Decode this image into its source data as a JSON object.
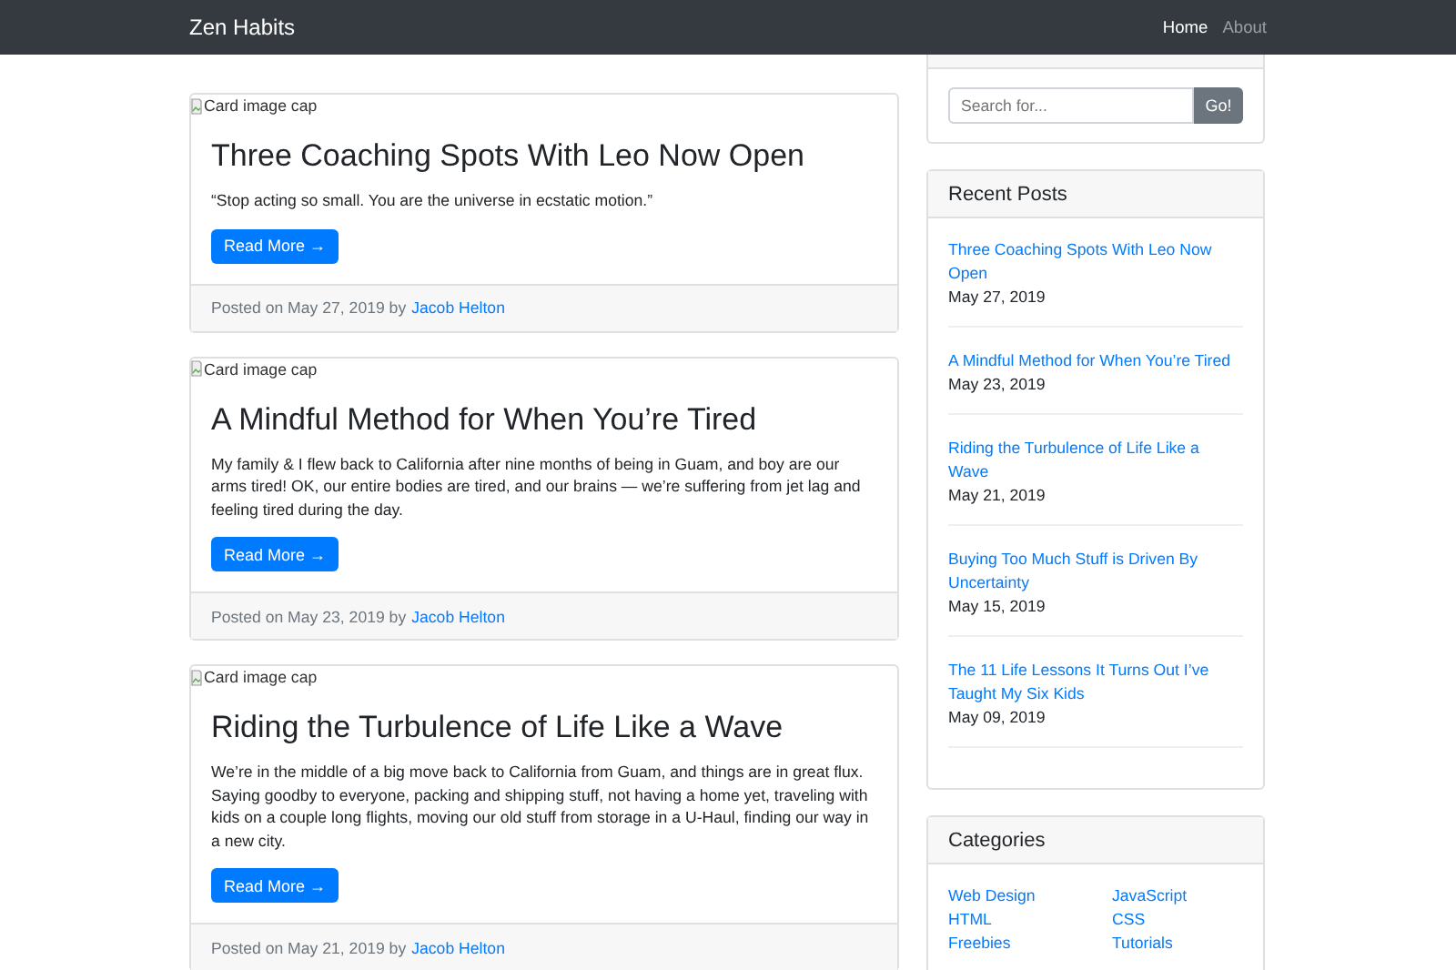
{
  "navbar": {
    "brand": "Zen Habits",
    "links": [
      {
        "label": "Home",
        "selected": true
      },
      {
        "label": "About",
        "selected": false
      }
    ]
  },
  "posts": [
    {
      "image_alt": "Card image cap",
      "title": "Three Coaching Spots With Leo Now Open",
      "excerpt": "“Stop acting so small. You are the universe in ecstatic motion.”",
      "button": "Read More →",
      "posted": "Posted on May 27, 2019 by",
      "author": "Jacob Helton"
    },
    {
      "image_alt": "Card image cap",
      "title": "A Mindful Method for When You’re Tired",
      "excerpt": "My family & I flew back to California after nine months of being in Guam, and boy are our arms tired! OK, our entire bodies are tired, and our brains — we’re suffering from jet lag and feeling tired during the day.",
      "button": "Read More →",
      "posted": "Posted on May 23, 2019 by",
      "author": "Jacob Helton"
    },
    {
      "image_alt": "Card image cap",
      "title": "Riding the Turbulence of Life Like a Wave",
      "excerpt": "We’re in the middle of a big move back to California from Guam, and things are in great flux. Saying goodby to everyone, packing and shipping stuff, not having a home yet, traveling with kids on a couple long flights, moving our old stuff from storage in a U-Haul, finding our way in a new city.",
      "button": "Read More →",
      "posted": "Posted on May 21, 2019 by",
      "author": "Jacob Helton"
    }
  ],
  "search": {
    "placeholder": "Search for...",
    "button": "Go!"
  },
  "recent_posts": {
    "title": "Recent Posts",
    "items": [
      {
        "title": "Three Coaching Spots With Leo Now Open",
        "date": "May 27, 2019"
      },
      {
        "title": "A Mindful Method for When You’re Tired",
        "date": "May 23, 2019"
      },
      {
        "title": "Riding the Turbulence of Life Like a Wave",
        "date": "May 21, 2019"
      },
      {
        "title": "Buying Too Much Stuff is Driven By Uncertainty",
        "date": "May 15, 2019"
      },
      {
        "title": "The 11 Life Lessons It Turns Out I’ve Taught My Six Kids",
        "date": "May 09, 2019"
      }
    ]
  },
  "categories": {
    "title": "Categories",
    "columns": [
      [
        "Web Design",
        "HTML",
        "Freebies"
      ],
      [
        "JavaScript",
        "CSS",
        "Tutorials"
      ]
    ]
  }
}
